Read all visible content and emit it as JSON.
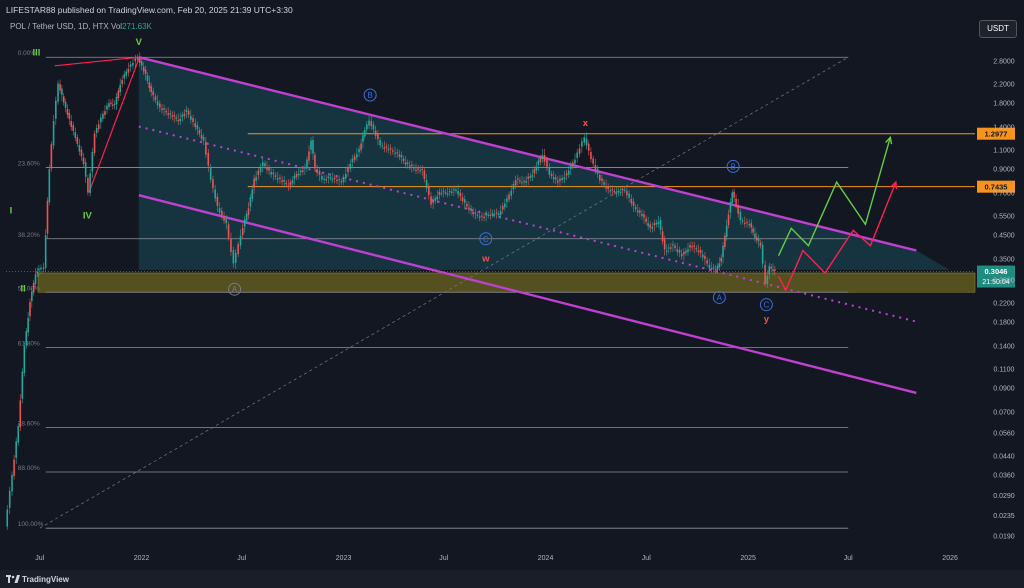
{
  "header": {
    "publish_line": "LIFESTAR88 published on TradingView.com, Feb 20, 2025 21:39 UTC+3:30"
  },
  "symbol": {
    "name": "POL / Tether USD, 1D, HTX",
    "vol_label": "Vol",
    "vol_value": "271.63K"
  },
  "currency_button": "USDT",
  "brand": "TradingView",
  "colors": {
    "background": "#131722",
    "up": "#26a69a",
    "down": "#ef5350",
    "channel": "#c040d0",
    "orange": "#f7931a",
    "zone": "#6b6420",
    "green_path": "#66cc44",
    "red_path": "#ff2050",
    "wave_blue": "#3b6fd8"
  },
  "chart_data": {
    "type": "line",
    "title": "",
    "y_scale": "log",
    "ylim": [
      0.017,
      4.2
    ],
    "xlim": [
      "2021-05-01",
      "2026-02-15"
    ],
    "x_ticks": [
      {
        "date": "2021-07-01",
        "label": "Jul"
      },
      {
        "date": "2022-01-01",
        "label": "2022"
      },
      {
        "date": "2022-07-01",
        "label": "Jul"
      },
      {
        "date": "2023-01-01",
        "label": "2023"
      },
      {
        "date": "2023-07-01",
        "label": "Jul"
      },
      {
        "date": "2024-01-01",
        "label": "2024"
      },
      {
        "date": "2024-07-01",
        "label": "Jul"
      },
      {
        "date": "2025-01-01",
        "label": "2025"
      },
      {
        "date": "2025-07-01",
        "label": "Jul"
      },
      {
        "date": "2026-01-01",
        "label": "2026"
      }
    ],
    "y_ticks": [
      "3.6000",
      "2.8000",
      "2.2000",
      "1.8000",
      "1.4000",
      "1.1000",
      "0.9000",
      "0.7000",
      "0.5500",
      "0.4500",
      "0.3500",
      "0.2800",
      "0.2200",
      "0.1800",
      "0.1400",
      "0.1100",
      "0.0900",
      "0.0700",
      "0.0560",
      "0.0440",
      "0.0360",
      "0.0290",
      "0.0235",
      "0.0190"
    ],
    "price_series": {
      "name": "",
      "points": [
        [
          "2021-05-01",
          0.021
        ],
        [
          "2021-05-10",
          0.03
        ],
        [
          "2021-05-25",
          0.06
        ],
        [
          "2021-06-05",
          0.14
        ],
        [
          "2021-06-15",
          0.22
        ],
        [
          "2021-06-25",
          0.3
        ],
        [
          "2021-07-01",
          0.31
        ],
        [
          "2021-07-10",
          0.32
        ],
        [
          "2021-07-20",
          0.9
        ],
        [
          "2021-07-28",
          1.5
        ],
        [
          "2021-08-05",
          2.2
        ],
        [
          "2021-08-15",
          1.8
        ],
        [
          "2021-08-25",
          1.5
        ],
        [
          "2021-09-05",
          1.25
        ],
        [
          "2021-09-20",
          0.95
        ],
        [
          "2021-09-28",
          0.7
        ],
        [
          "2021-10-10",
          1.3
        ],
        [
          "2021-10-25",
          1.6
        ],
        [
          "2021-11-05",
          1.8
        ],
        [
          "2021-11-15",
          1.75
        ],
        [
          "2021-11-25",
          2.2
        ],
        [
          "2021-12-10",
          2.6
        ],
        [
          "2021-12-27",
          2.9
        ],
        [
          "2022-01-10",
          2.4
        ],
        [
          "2022-01-20",
          2.0
        ],
        [
          "2022-02-05",
          1.7
        ],
        [
          "2022-02-20",
          1.6
        ],
        [
          "2022-03-10",
          1.5
        ],
        [
          "2022-03-25",
          1.65
        ],
        [
          "2022-04-10",
          1.4
        ],
        [
          "2022-04-25",
          1.2
        ],
        [
          "2022-05-08",
          0.8
        ],
        [
          "2022-05-20",
          0.6
        ],
        [
          "2022-06-05",
          0.5
        ],
        [
          "2022-06-18",
          0.33
        ],
        [
          "2022-07-01",
          0.45
        ],
        [
          "2022-07-15",
          0.6
        ],
        [
          "2022-07-25",
          0.8
        ],
        [
          "2022-08-10",
          0.95
        ],
        [
          "2022-08-25",
          0.85
        ],
        [
          "2022-09-10",
          0.8
        ],
        [
          "2022-09-25",
          0.75
        ],
        [
          "2022-10-10",
          0.85
        ],
        [
          "2022-10-25",
          0.9
        ],
        [
          "2022-11-05",
          1.2
        ],
        [
          "2022-11-12",
          0.9
        ],
        [
          "2022-11-25",
          0.8
        ],
        [
          "2022-12-10",
          0.82
        ],
        [
          "2022-12-30",
          0.78
        ],
        [
          "2023-01-15",
          0.95
        ],
        [
          "2023-01-31",
          1.1
        ],
        [
          "2023-02-10",
          1.35
        ],
        [
          "2023-02-18",
          1.5
        ],
        [
          "2023-03-10",
          1.15
        ],
        [
          "2023-03-25",
          1.1
        ],
        [
          "2023-04-10",
          1.05
        ],
        [
          "2023-04-25",
          0.95
        ],
        [
          "2023-05-10",
          0.9
        ],
        [
          "2023-05-25",
          0.88
        ],
        [
          "2023-06-10",
          0.62
        ],
        [
          "2023-06-25",
          0.7
        ],
        [
          "2023-07-10",
          0.7
        ],
        [
          "2023-07-25",
          0.72
        ],
        [
          "2023-08-10",
          0.62
        ],
        [
          "2023-08-25",
          0.56
        ],
        [
          "2023-09-10",
          0.54
        ],
        [
          "2023-09-25",
          0.56
        ],
        [
          "2023-10-10",
          0.56
        ],
        [
          "2023-10-25",
          0.65
        ],
        [
          "2023-11-10",
          0.8
        ],
        [
          "2023-11-25",
          0.78
        ],
        [
          "2023-12-10",
          0.85
        ],
        [
          "2023-12-28",
          1.05
        ],
        [
          "2024-01-10",
          0.85
        ],
        [
          "2024-01-25",
          0.78
        ],
        [
          "2024-02-10",
          0.85
        ],
        [
          "2024-02-25",
          1.0
        ],
        [
          "2024-03-13",
          1.25
        ],
        [
          "2024-03-25",
          1.0
        ],
        [
          "2024-04-10",
          0.8
        ],
        [
          "2024-04-25",
          0.72
        ],
        [
          "2024-05-10",
          0.7
        ],
        [
          "2024-05-25",
          0.72
        ],
        [
          "2024-06-10",
          0.6
        ],
        [
          "2024-06-25",
          0.55
        ],
        [
          "2024-07-10",
          0.48
        ],
        [
          "2024-07-25",
          0.52
        ],
        [
          "2024-08-05",
          0.38
        ],
        [
          "2024-08-20",
          0.4
        ],
        [
          "2024-09-05",
          0.36
        ],
        [
          "2024-09-20",
          0.4
        ],
        [
          "2024-10-05",
          0.38
        ],
        [
          "2024-10-25",
          0.32
        ],
        [
          "2024-11-05",
          0.31
        ],
        [
          "2024-11-15",
          0.35
        ],
        [
          "2024-11-25",
          0.5
        ],
        [
          "2024-12-05",
          0.7
        ],
        [
          "2024-12-12",
          0.62
        ],
        [
          "2024-12-20",
          0.52
        ],
        [
          "2025-01-05",
          0.5
        ],
        [
          "2025-01-15",
          0.44
        ],
        [
          "2025-01-25",
          0.4
        ],
        [
          "2025-02-03",
          0.27
        ],
        [
          "2025-02-10",
          0.32
        ],
        [
          "2025-02-20",
          0.3046
        ]
      ]
    },
    "current_price": {
      "value": 0.3046,
      "label": "0.3046",
      "countdown": "21:50:04"
    },
    "horizontal_levels": [
      {
        "value": 1.2977,
        "label": "1.2977",
        "color": "#f7931a"
      },
      {
        "value": 0.7435,
        "label": "0.7435",
        "color": "#f7931a"
      }
    ],
    "support_zone": {
      "low": 0.245,
      "high": 0.3
    },
    "fib_levels": [
      {
        "label": "0.00%",
        "value": 2.9,
        "x_start": "2021-07-01",
        "x_end": "2025-07-01"
      },
      {
        "label": "23.60%",
        "value": 0.91,
        "x_start": "2021-07-01",
        "x_end": "2025-07-01"
      },
      {
        "label": "38.20%",
        "value": 0.43,
        "x_start": "2021-07-01",
        "x_end": "2025-07-01"
      },
      {
        "label": "50.00%",
        "value": 0.245,
        "x_start": "2021-07-01",
        "x_end": "2025-07-01"
      },
      {
        "label": "61.80%",
        "value": 0.137,
        "x_start": "2021-07-01",
        "x_end": "2025-07-01"
      },
      {
        "label": "78.60%",
        "value": 0.059,
        "x_start": "2021-07-01",
        "x_end": "2025-07-01"
      },
      {
        "label": "88.00%",
        "value": 0.037,
        "x_start": "2021-07-01",
        "x_end": "2025-07-01"
      },
      {
        "label": "100.00%",
        "value": 0.0205,
        "x_start": "2021-07-01",
        "x_end": "2025-07-01"
      }
    ],
    "channel": {
      "upper": [
        [
          "2021-12-27",
          2.9
        ],
        [
          "2025-11-01",
          0.38
        ]
      ],
      "lower": [
        [
          "2021-12-27",
          0.68
        ],
        [
          "2025-11-01",
          0.085
        ]
      ],
      "mid": [
        [
          "2021-12-27",
          1.4
        ],
        [
          "2025-11-01",
          0.18
        ]
      ],
      "fill_box": [
        [
          "2021-12-27",
          2.9
        ],
        [
          "2025-12-31",
          0.31
        ]
      ]
    },
    "diagonal_trend": [
      [
        "2021-07-01",
        0.0205
      ],
      [
        "2025-07-01",
        2.9
      ]
    ],
    "red_lines": [
      [
        [
          "2021-07-28",
          2.65
        ],
        [
          "2021-12-27",
          2.9
        ]
      ],
      [
        [
          "2021-09-28",
          0.7
        ],
        [
          "2021-12-27",
          2.85
        ]
      ]
    ],
    "projections": [
      {
        "name": "",
        "color": "#66cc44",
        "points": [
          [
            "2025-02-25",
            0.36
          ],
          [
            "2025-03-20",
            0.48
          ],
          [
            "2025-04-20",
            0.4
          ],
          [
            "2025-06-10",
            0.78
          ],
          [
            "2025-08-01",
            0.5
          ],
          [
            "2025-09-15",
            1.25
          ]
        ]
      },
      {
        "name": "",
        "color": "#ff2050",
        "points": [
          [
            "2025-02-25",
            0.29
          ],
          [
            "2025-03-10",
            0.25
          ],
          [
            "2025-04-10",
            0.38
          ],
          [
            "2025-05-20",
            0.3
          ],
          [
            "2025-07-10",
            0.47
          ],
          [
            "2025-08-10",
            0.4
          ],
          [
            "2025-09-25",
            0.78
          ]
        ]
      }
    ],
    "wave_labels": [
      {
        "text": "III",
        "date": "2021-06-25",
        "value": 3.05,
        "color": "#66cc44",
        "circle": false
      },
      {
        "text": "V",
        "date": "2021-12-27",
        "value": 3.4,
        "color": "#66cc44",
        "circle": false
      },
      {
        "text": "IV",
        "date": "2021-09-25",
        "value": 0.55,
        "color": "#66cc44",
        "circle": false
      },
      {
        "text": "I",
        "date": "2021-05-10",
        "value": 0.58,
        "color": "#66cc44",
        "circle": false
      },
      {
        "text": "II",
        "date": "2021-06-01",
        "value": 0.255,
        "color": "#66cc44",
        "circle": false
      },
      {
        "text": "B",
        "date": "2023-02-18",
        "value": 1.95,
        "color": "#3b6fd8",
        "circle": true
      },
      {
        "text": "C",
        "date": "2023-09-15",
        "value": 0.43,
        "color": "#3b6fd8",
        "circle": true
      },
      {
        "text": "w",
        "date": "2023-09-15",
        "value": 0.35,
        "color": "#ef5350",
        "circle": false
      },
      {
        "text": "x",
        "date": "2024-03-13",
        "value": 1.45,
        "color": "#ef5350",
        "circle": false
      },
      {
        "text": "B",
        "date": "2024-12-05",
        "value": 0.92,
        "color": "#3b6fd8",
        "circle": true
      },
      {
        "text": "A",
        "date": "2022-06-18",
        "value": 0.253,
        "color": "#787b86",
        "circle": true
      },
      {
        "text": "A",
        "date": "2024-11-10",
        "value": 0.232,
        "color": "#3b6fd8",
        "circle": true
      },
      {
        "text": "C",
        "date": "2025-02-03",
        "value": 0.215,
        "color": "#3b6fd8",
        "circle": true
      },
      {
        "text": "y",
        "date": "2025-02-03",
        "value": 0.185,
        "color": "#ef5350",
        "circle": false
      }
    ]
  }
}
